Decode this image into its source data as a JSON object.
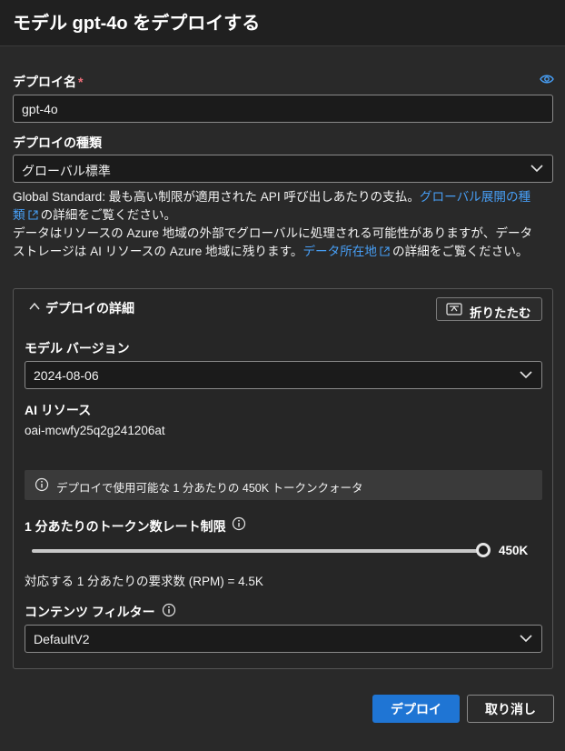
{
  "header": {
    "title": "モデル gpt-4o をデプロイする"
  },
  "deploy_name": {
    "label": "デプロイ名",
    "required_mark": "*",
    "value": "gpt-4o"
  },
  "deploy_type": {
    "label": "デプロイの種類",
    "selected": "グローバル標準"
  },
  "description": {
    "line1_pre": "Global Standard: 最も高い制限が適用された API 呼び出しあたりの支払。",
    "link1_part1": "グローバル展開の種",
    "link1_part2": "類",
    "line2_post": "の詳細をご覧ください。",
    "line3": "データはリソースの Azure 地域の外部でグローバルに処理される可能性がありますが、データ",
    "line4_pre": "ストレージは AI リソースの Azure 地域に残ります。",
    "link2": "データ所在地",
    "line4_post": "の詳細をご覧ください。"
  },
  "details": {
    "title": "デプロイの詳細",
    "collapse_label": "折りたたむ",
    "model_version": {
      "label": "モデル バージョン",
      "selected": "2024-08-06"
    },
    "ai_resource": {
      "label": "AI リソース",
      "value": "oai-mcwfy25q2g241206at"
    },
    "quota_info": "デプロイで使用可能な 1 分あたりの 450K トークンクォータ",
    "rate_limit": {
      "label": "1 分あたりのトークン数レート制限",
      "value_label": "450K",
      "fill_fraction": 1.0
    },
    "rpm_text": "対応する 1 分あたりの要求数 (RPM) = 4.5K",
    "content_filter": {
      "label": "コンテンツ フィルター",
      "selected": "DefaultV2"
    }
  },
  "actions": {
    "deploy": "デプロイ",
    "cancel": "取り消し"
  },
  "colors": {
    "accent": "#1f75d4",
    "link": "#479ef5",
    "required": "#f1707b"
  }
}
